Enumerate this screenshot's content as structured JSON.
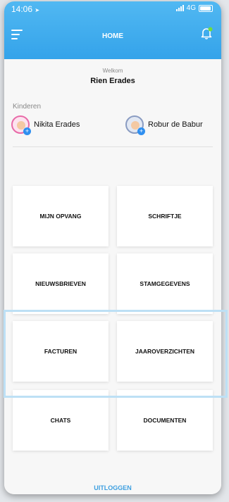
{
  "status_bar": {
    "time": "14:06",
    "network": "4G"
  },
  "header": {
    "title": "HOME"
  },
  "welcome": {
    "label": "Welkom",
    "name": "Rien Erades"
  },
  "kids": {
    "title": "Kinderen",
    "items": [
      {
        "name": "Nikita Erades"
      },
      {
        "name": "Robur de Babur"
      }
    ]
  },
  "menu_tiles": [
    {
      "label": "MIJN OPVANG"
    },
    {
      "label": "SCHRIFTJE"
    },
    {
      "label": "NIEUWSBRIEVEN"
    },
    {
      "label": "STAMGEGEVENS"
    },
    {
      "label": "FACTUREN"
    },
    {
      "label": "JAAROVERZICHTEN"
    },
    {
      "label": "CHATS"
    },
    {
      "label": "DOCUMENTEN"
    }
  ],
  "footer": {
    "logout_label": "UITLOGGEN"
  },
  "colors": {
    "header": "#3aa8ee",
    "accent": "#3d9fe0",
    "notification_dot": "#6fdc3c"
  }
}
